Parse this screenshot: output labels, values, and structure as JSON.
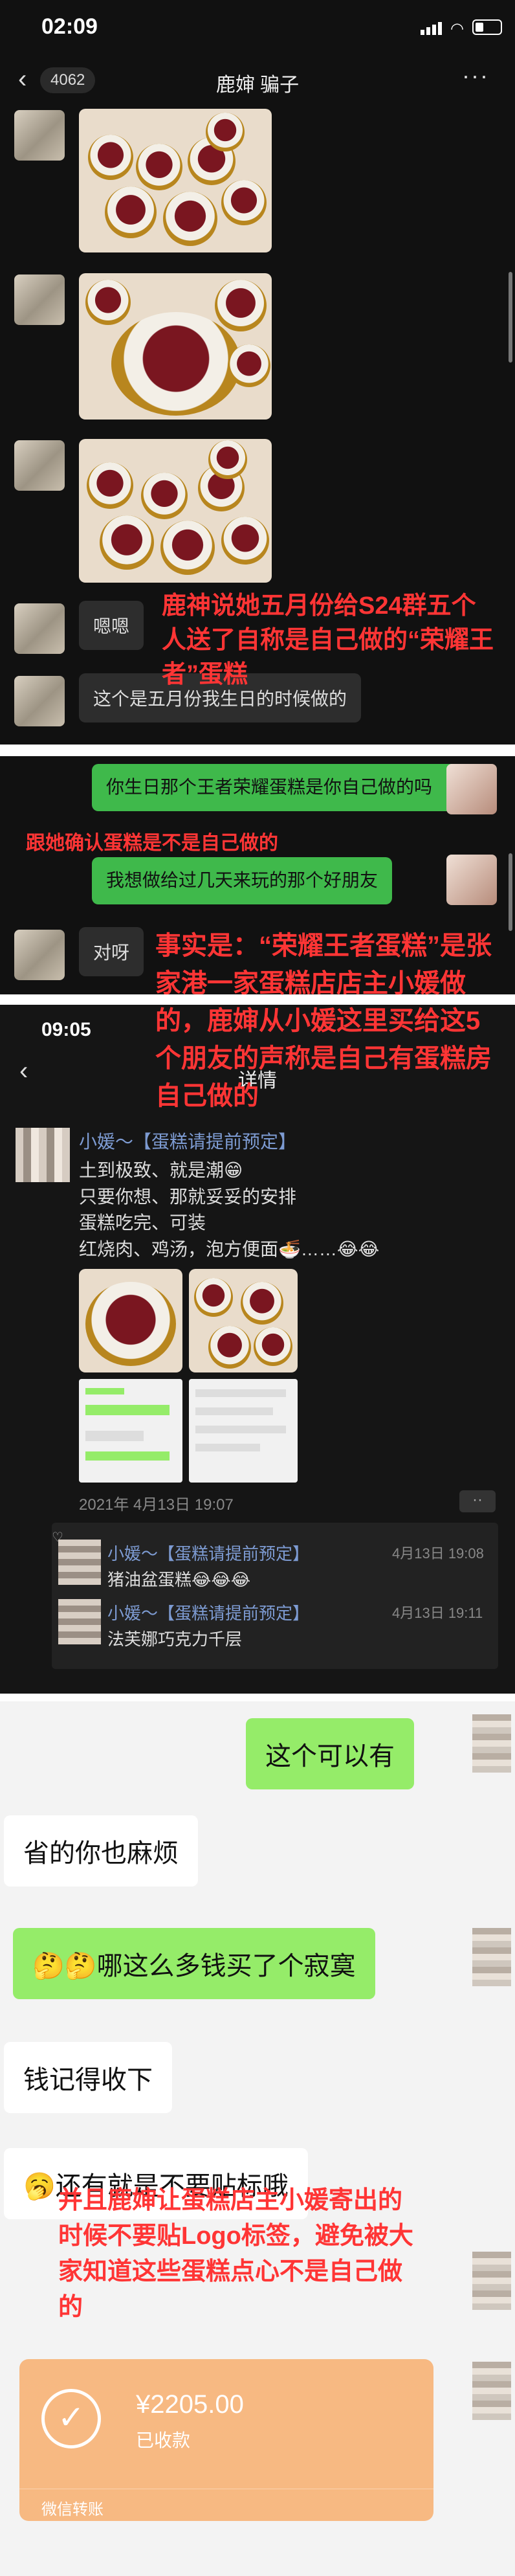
{
  "status": {
    "time": "02:09"
  },
  "nav": {
    "back_count": "4062",
    "title": "鹿婶 骗子"
  },
  "sec1": {
    "msg_enne": "嗯嗯",
    "msg_birthday": "这个是五月份我生日的时候做的",
    "annotation": "鹿神说她五月份给S24群五个人送了自称是自己做的“荣耀王者”蛋糕"
  },
  "sec2": {
    "out_q": "你生日那个王者荣耀蛋糕是你自己做的吗",
    "out_a": "我想做给过几天来玩的那个好朋友",
    "reply": "对呀",
    "annotation_confirm": "跟她确认蛋糕是不是自己做的",
    "annotation_fact": "事实是：“荣耀王者蛋糕”是张家港一家蛋糕店店主小媛做的，鹿婶从小媛这里买给这5个朋友的声称是自己有蛋糕房自己做的"
  },
  "moments": {
    "time": "09:05",
    "title": "详情",
    "author": "小媛～【蛋糕请提前预定】",
    "lines": [
      "土到极致、就是潮😁",
      "只要你想、那就妥妥的安排",
      "蛋糕吃完、可装",
      "红烧肉、鸡汤，泡方便面🍜……😂😂"
    ],
    "date": "2021年 4月13日 19:07",
    "comments": [
      {
        "name": "小媛～【蛋糕请提前预定】",
        "text": "猪油盆蛋糕😂😂😂",
        "time": "4月13日 19:08"
      },
      {
        "name": "小媛～【蛋糕请提前预定】",
        "text": "法芙娜巧克力千层",
        "time": "4月13日 19:11"
      }
    ]
  },
  "sec3": {
    "m1": "这个可以有",
    "m2": "省的你也麻烦",
    "m3": "🤔🤔哪这么多钱买了个寂寞",
    "m4": "钱记得收下",
    "m5": "🥱还有就是不要贴标哦",
    "annotation": "并且鹿婶让蛋糕店主小媛寄出的时候不要贴Logo标签，避免被大家知道这些蛋糕点心不是自己做的",
    "pay_amount": "¥2205.00",
    "pay_status": "已收款",
    "pay_label": "微信转账"
  }
}
